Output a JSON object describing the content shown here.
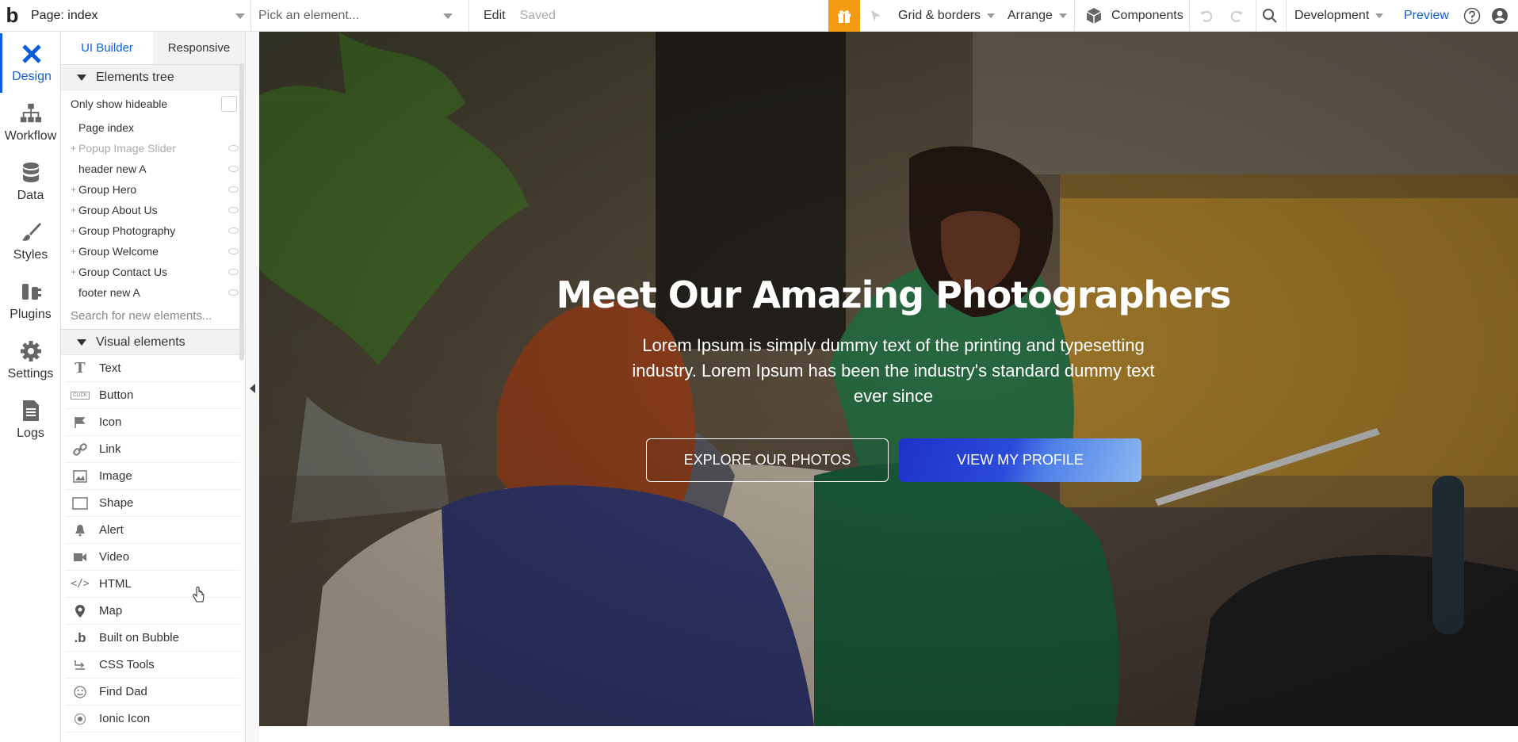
{
  "topbar": {
    "logo": "b",
    "page_select": "Page: index",
    "element_select_placeholder": "Pick an element...",
    "edit": "Edit",
    "saved": "Saved",
    "grid_borders": "Grid & borders",
    "arrange": "Arrange",
    "components": "Components",
    "environment": "Development",
    "preview": "Preview"
  },
  "iconbar": {
    "items": [
      {
        "label": "Design"
      },
      {
        "label": "Workflow"
      },
      {
        "label": "Data"
      },
      {
        "label": "Styles"
      },
      {
        "label": "Plugins"
      },
      {
        "label": "Settings"
      },
      {
        "label": "Logs"
      }
    ]
  },
  "panel": {
    "tabs": [
      "UI Builder",
      "Responsive"
    ],
    "elements_tree_title": "Elements tree",
    "only_show_hideable": "Only show hideable",
    "tree": [
      {
        "label": "Page index",
        "plus": false,
        "muted": false,
        "eye": false
      },
      {
        "label": "Popup Image Slider",
        "plus": true,
        "muted": true,
        "eye": true
      },
      {
        "label": "header new A",
        "plus": false,
        "muted": false,
        "eye": true
      },
      {
        "label": "Group Hero",
        "plus": true,
        "muted": false,
        "eye": true
      },
      {
        "label": "Group About Us",
        "plus": true,
        "muted": false,
        "eye": true
      },
      {
        "label": "Group Photography",
        "plus": true,
        "muted": false,
        "eye": true
      },
      {
        "label": "Group Welcome",
        "plus": true,
        "muted": false,
        "eye": true
      },
      {
        "label": "Group Contact Us",
        "plus": true,
        "muted": false,
        "eye": true
      },
      {
        "label": "footer new A",
        "plus": false,
        "muted": false,
        "eye": true
      }
    ],
    "search_placeholder": "Search for new elements...",
    "visual_elements_title": "Visual elements",
    "visual_elements": [
      {
        "label": "Text",
        "icon": "text-icon"
      },
      {
        "label": "Button",
        "icon": "button-icon"
      },
      {
        "label": "Icon",
        "icon": "flag-icon"
      },
      {
        "label": "Link",
        "icon": "link-icon"
      },
      {
        "label": "Image",
        "icon": "image-icon"
      },
      {
        "label": "Shape",
        "icon": "shape-icon"
      },
      {
        "label": "Alert",
        "icon": "bell-icon"
      },
      {
        "label": "Video",
        "icon": "video-icon"
      },
      {
        "label": "HTML",
        "icon": "code-icon"
      },
      {
        "label": "Map",
        "icon": "map-pin-icon"
      },
      {
        "label": "Built on Bubble",
        "icon": "bubble-logo-icon"
      },
      {
        "label": "CSS Tools",
        "icon": "css-tools-icon"
      },
      {
        "label": "Find Dad",
        "icon": "smiley-icon"
      },
      {
        "label": "Ionic Icon",
        "icon": "ionic-icon"
      }
    ]
  },
  "hero": {
    "title": "Meet Our Amazing Photographers",
    "subtitle": "Lorem Ipsum is simply dummy text of the printing and typesetting industry. Lorem Ipsum has been the industry's standard dummy text ever since",
    "btn_explore": "EXPLORE OUR PHOTOS",
    "btn_profile": "VIEW MY PROFILE"
  },
  "colors": {
    "accent": "#0d5fd9",
    "gift": "#f39c12",
    "profile_button": "#2b4ad8"
  }
}
